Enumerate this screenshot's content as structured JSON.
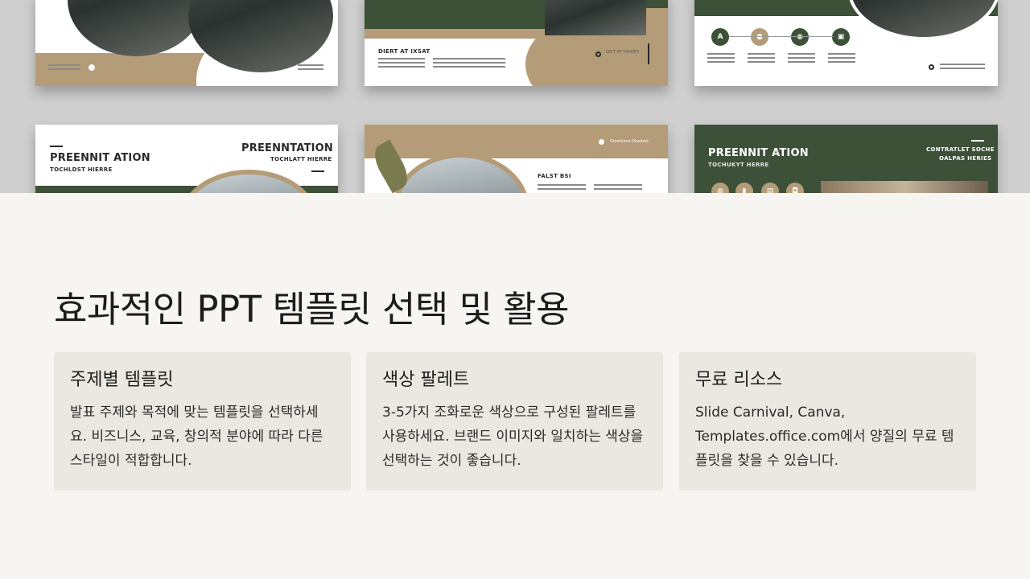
{
  "hero": {
    "slides": [
      {
        "title": "PREENNIT ATION",
        "subtitle": "TOCHLDST HIERRE"
      },
      {
        "title": "PREENNTATION",
        "subtitle": "TOCHLATT HIERRE"
      },
      {
        "title": "PREENNIT ATION",
        "subtitle": "TOCHUKYT HERRE"
      }
    ],
    "top_labels": {
      "a": "DIERT AT IXSAT",
      "b": "FALST BSI",
      "c": "CONTRATLET SOCHE",
      "d": "OALPAS HERIES",
      "e": "Orestiums Dhedest",
      "f": "DICT AT TIXAITO"
    },
    "icon_letter": "A"
  },
  "main": {
    "heading": "효과적인 PPT 템플릿 선택 및 활용",
    "cards": [
      {
        "title": "주제별 템플릿",
        "body": "발표 주제와 목적에 맞는 템플릿을 선택하세요. 비즈니스, 교육, 창의적 분야에 따라 다른 스타일이 적합합니다."
      },
      {
        "title": "색상 팔레트",
        "body": "3-5가지 조화로운 색상으로 구성된 팔레트를 사용하세요. 브랜드 이미지와 일치하는 색상을 선택하는 것이 좋습니다."
      },
      {
        "title": "무료 리소스",
        "body": "Slide Carnival, Canva, Templates.office.com에서 양질의 무료 템플릿을 찾을 수 있습니다."
      }
    ]
  },
  "colors": {
    "background": "#f7f5f1",
    "card": "#ebe8e1",
    "forest_green": "#3d5038",
    "tan": "#b39c77"
  }
}
